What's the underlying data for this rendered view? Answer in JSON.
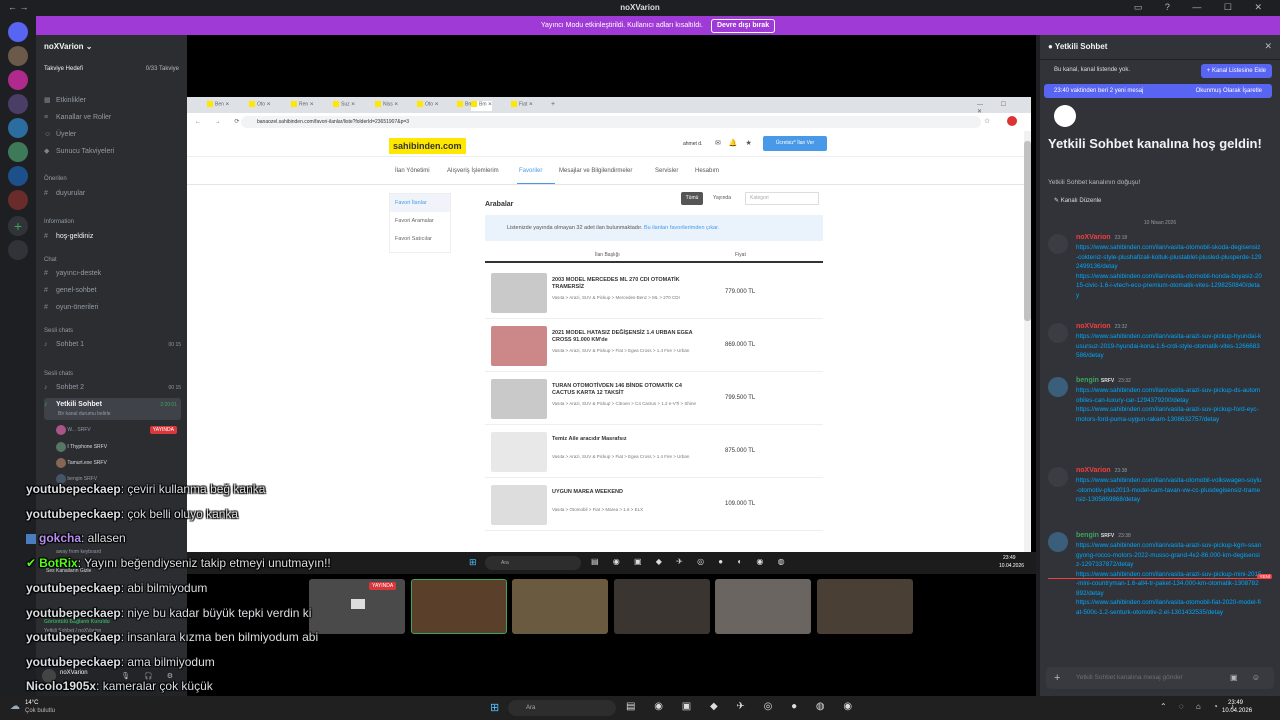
{
  "window": {
    "title": "noXVarion"
  },
  "banner": {
    "text": "Yayıncı Modu etkinleştirildi. Kullanıcı adları kısaltıldı.",
    "button": "Devre dışı bırak"
  },
  "server": {
    "name": "noXVarion",
    "boost_label": "Takviye Hedefi",
    "boost_count": "0/33 Takviye",
    "menu": [
      "Etkinlikler",
      "Kanallar ve Roller",
      "Üyeler",
      "Sunucu Takviyeleri"
    ],
    "cat_featured": "Önerilen",
    "featured": [
      "duyurular"
    ],
    "cat_info": "Information",
    "info_channels": [
      "hoş-geldiniz"
    ],
    "cat_chat": "Chat",
    "chat_channels": [
      "yayıncı-destek",
      "genel-sohbet",
      "oyun-önerileri"
    ],
    "cat_voice": "Sesli chats",
    "voice1": {
      "name": "Sohbet 1",
      "a": "00",
      "b": "15"
    },
    "cat_voice2": "Sesli chats",
    "voice2": {
      "name": "Sohbet 2",
      "a": "00",
      "b": "15"
    },
    "active": {
      "name": "Yetkili Sohbet",
      "status": "Bir kanal durumu belirle",
      "time": "2:20:01"
    },
    "members": [
      {
        "name": "W...",
        "tag": "SRFV",
        "badge": "YAYINDA"
      },
      {
        "name": "I Thyphone",
        "tag": "SRFV"
      },
      {
        "name": "Tamurt.exe",
        "tag": "SRFV"
      },
      {
        "name": "bengin",
        "tag": "SRFV"
      }
    ],
    "voice_panel": {
      "status": "Görüntülü Bağlantı Kuruldu",
      "sub": "Yetkili Sohbet / noXVarion",
      "user": "noXVarion",
      "user_status": "away from keyboard"
    },
    "user_status_line": "Ses Kanalların Gizle"
  },
  "browser": {
    "tabs": [
      "Ben",
      "Oto",
      "Ren",
      "Suz",
      "Niss",
      "Oto",
      "Bm",
      "Bm",
      "Fiat"
    ],
    "url": "banaozel.sahibinden.com/favori-ilanlar/liste?folderId=23651907&p=3",
    "site": {
      "logo": "sahibinden.com",
      "user": "ahmet d.",
      "post_button": "Ücretsiz* İlan Ver",
      "menu": [
        "İlan Yönetimi",
        "Alışveriş İşlemlerim",
        "Favoriler",
        "Mesajlar ve Bilgilendirmeler",
        "Servisler",
        "Hesabım"
      ],
      "side": [
        "Favori İlanlar",
        "Favori Aramalar",
        "Favori Satıcılar"
      ],
      "section_title": "Arabalar",
      "filters": [
        "Tümü",
        "Yayında"
      ],
      "category_placeholder": "Kategori",
      "notice": "Listenizde yayında olmayan 32 adet ilan bulunmaktadır.",
      "notice_link": "Bu ilanları favorilerimden çıkar.",
      "col_title": "İlan Başlığı",
      "col_price": "Fiyat",
      "listings": [
        {
          "title": "2003 MODEL MERCEDES ML 270 CDI OTOMATİK TRAMERSİZ",
          "sub": "Vasıta > Arazi, SUV & Pickup > Mercedes-Benz > ML > 270 CDI",
          "price": "779.000 TL"
        },
        {
          "title": "2021 MODEL HATASIZ DEĞİŞENSİZ 1.4 URBAN EGEA CROSS 91.000 KM'de",
          "sub": "Vasıta > Arazi, SUV & Pickup > Fiat > Egea Cross > 1.4 Fire > Urban",
          "price": "869.000 TL"
        },
        {
          "title": "TURAN OTOMOTİVDEN 146 BİNDE OTOMATİK C4 CACTUS KARTA 12 TAKSİT",
          "sub": "Vasıta > Arazi, SUV & Pickup > Citroen > C4 Cactus > 1.2 e-VTi > Shine",
          "price": "799.500 TL"
        },
        {
          "title": "Temiz Aile aracıdır Masrafsız",
          "sub": "Vasıta > Arazi, SUV & Pickup > Fiat > Egea Cross > 1.4 Fire > Urban",
          "price": "875.000 TL"
        },
        {
          "title": "UYGUN MAREA WEEKEND",
          "sub": "Vasıta > Otomobil > Fiat > Marea > 1.6 > ELX",
          "price": "109.000 TL"
        }
      ]
    }
  },
  "stream_taskbar": {
    "search": "Ara",
    "time": "23:49",
    "date": "10.04.2026"
  },
  "cams": {
    "badge": "YAYINDA"
  },
  "overlay_chat": [
    {
      "user": "youtubepeckaep",
      "text": ": çeviri kullanma beğ kanka",
      "color": "#ffffff"
    },
    {
      "user": "youtubepeckaep",
      "text": ": çok belli oluyo kanka",
      "color": "#ffffff"
    },
    {
      "user": "gokcha",
      "text": ": allasen",
      "color": "#b88df0"
    },
    {
      "user": "BotRix",
      "text": ": Yayını beğendiyseniz takip etmeyi unutmayın!!",
      "color": "#53fc18"
    },
    {
      "user": "youtubepeckaep",
      "text": ": abi bilmiyodum",
      "color": "#ffffff"
    },
    {
      "user": "youtubepeckaep",
      "text": ": niye bu kadar büyük tepki verdin ki",
      "color": "#ffffff"
    },
    {
      "user": "youtubepeckaep",
      "text": ": insanlara kızma ben bilmiyodum abi",
      "color": "#ffffff"
    },
    {
      "user": "youtubepeckaep",
      "text": ": ama bilmiyodum",
      "color": "#ffffff"
    },
    {
      "user": "Nicolo1905x",
      "text": ": kameralar çok küçük",
      "color": "#ffffff"
    }
  ],
  "right_panel": {
    "title": "Yetkili Sohbet",
    "not_listed": "Bu kanal, kanal listende yok.",
    "add_button": "Kanal Listesine Ekle",
    "new_msgs": "23:40 vaktinden beri 2 yeni mesaj",
    "mark_read": "Okunmuş Olarak İşaretle",
    "welcome": "Yetkili Sohbet kanalına hoş geldin!",
    "welcome_sub": "Yetkili Sohbet kanalının doğuşu!",
    "edit_button": "Kanalı Düzenle",
    "date": "10 Nisan 2026",
    "new_badge": "YENİ",
    "messages": [
      {
        "user": "noXVarion",
        "time": "23:18",
        "color": "#f23f42",
        "links": [
          "https://www.sahibinden.com/ilan/vasita-otomobil-skoda-degisensiz-cokteniz-style-plushafizali-koltuk-plustablet-plusled-plusperde-1292499136/detay",
          "https://www.sahibinden.com/ilan/vasita-otomobil-honda-boyasiz-2015-civic-1.6-i-vtech-eco-premium-otomatik-vites-1298250840/detay"
        ]
      },
      {
        "user": "noXVarion",
        "time": "23:32",
        "color": "#f23f42",
        "links": [
          "https://www.sahibinden.com/ilan/vasita-arazi-suv-pickup-hyundai-kusursuz-2019-hyundai-kona-1.6-crdi-style-otomatik-vites-1266683586/detay"
        ]
      },
      {
        "user": "bengin",
        "time": "23:32",
        "color": "#3ba55d",
        "tag": "SRFV",
        "links": [
          "https://www.sahibinden.com/ilan/vasita-arazi-suv-pickup-ds-automobiles-can-luxury-car-1294379200/detay",
          "https://www.sahibinden.com/ilan/vasita-arazi-suv-pickup-ford-eyc-motors-ford-puma-uygun-rakam-1308632757/detay"
        ]
      },
      {
        "user": "noXVarion",
        "time": "23:38",
        "color": "#f23f42",
        "links": [
          "https://www.sahibinden.com/ilan/vasita-otomobil-volkswagen-soylu-otomotiv-plus2013-model-cam-tavan-vw-cc-plusdegisensiz-tramersiz-1305869868/detay"
        ]
      },
      {
        "user": "bengin",
        "time": "23:38",
        "color": "#3ba55d",
        "tag": "SRFV",
        "links": [
          "https://www.sahibinden.com/ilan/vasita-arazi-suv-pickup-kgm-ssangyong-rocco-motors-2022-musso-grand-4x2-86.000-km-degisensiz-1297337872/detay",
          "https://www.sahibinden.com/ilan/vasita-arazi-suv-pickup-mini-2015-mini-countryman-1.6-all4-tr-paket-134.000-km-otomatik-1308782892/detay",
          "https://www.sahibinden.com/ilan/vasita-otomobil-fiat-2020-model-fiat-500c-1.2-senturk-otomotiv-2.el-1301432535/detay"
        ]
      }
    ],
    "input_placeholder": "Yetkili Sohbet kanalına mesaj gönder"
  },
  "win_taskbar": {
    "weather_temp": "14°C",
    "weather_desc": "Çok bulutlu",
    "search": "Ara",
    "time": "23:49",
    "date": "10.04.2026"
  }
}
